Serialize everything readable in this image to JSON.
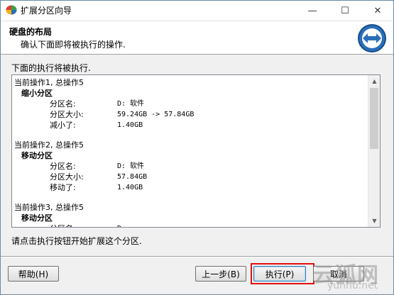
{
  "window": {
    "title": "扩展分区向导"
  },
  "titlebar": {
    "minimize": "—",
    "maximize": "☐",
    "close": "✕"
  },
  "banner": {
    "title": "硬盘的布局",
    "subtitle": "确认下面即将被执行的操作."
  },
  "section_label": "下面的执行将被执行.",
  "operations": [
    {
      "header": "当前操作1, 总操作5",
      "name": "缩小分区",
      "rows": [
        {
          "key": "分区名:",
          "value": "D: 软件"
        },
        {
          "key": "分区大小:",
          "value": "59.24GB -> 57.84GB"
        },
        {
          "key": "减小了:",
          "value": "1.40GB"
        }
      ]
    },
    {
      "header": "当前操作2, 总操作5",
      "name": "移动分区",
      "rows": [
        {
          "key": "分区名:",
          "value": "D: 软件"
        },
        {
          "key": "分区大小:",
          "value": "57.84GB"
        },
        {
          "key": "移动了:",
          "value": "1.40GB"
        }
      ]
    },
    {
      "header": "当前操作3, 总操作5",
      "name": "移动分区",
      "rows": [
        {
          "key": "分区名:",
          "value": "D:"
        }
      ]
    }
  ],
  "hint": "请点击执行按钮开始扩展这个分区.",
  "buttons": {
    "help": "帮助(H)",
    "back": "上一步(B)",
    "execute": "执行(P)",
    "cancel": "取消"
  },
  "watermark": {
    "cn": "云狐网",
    "en": "yunhu.net"
  },
  "colors": {
    "accent": "#3c7fb1",
    "highlight": "#e01010",
    "logo_blue": "#2a6fb8"
  }
}
